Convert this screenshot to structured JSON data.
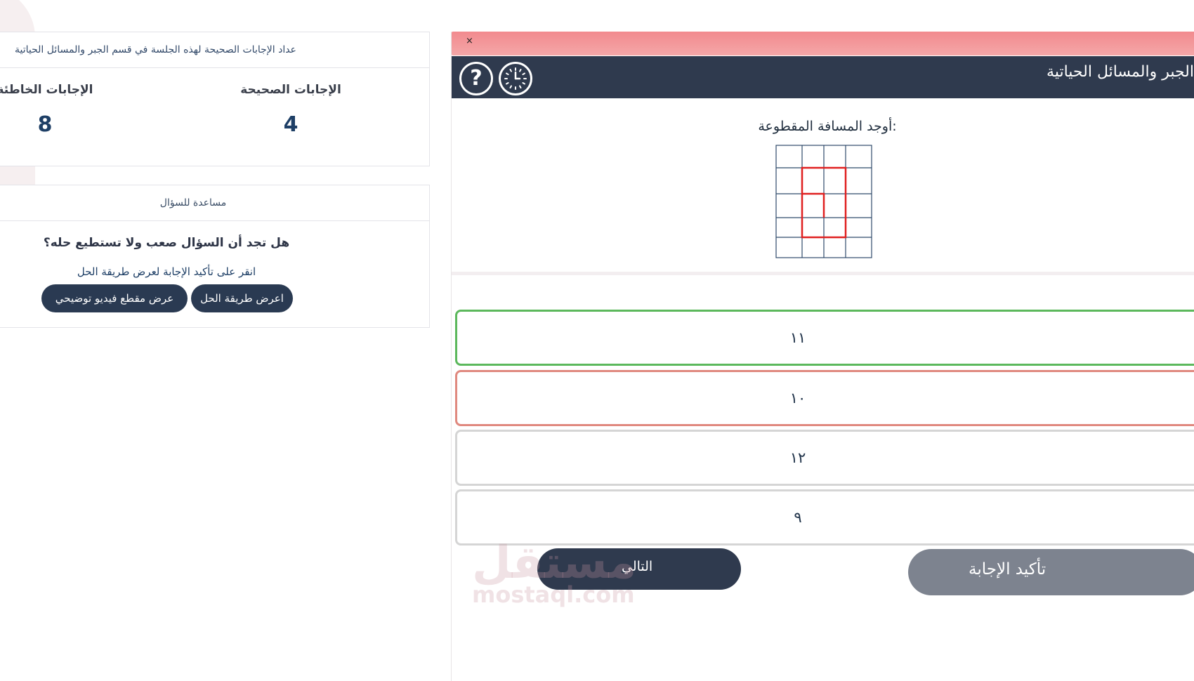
{
  "stats": {
    "header": "عداد الإجابات الصحيحة لهذه الجلسة في قسم الجبر والمسائل الحياتية",
    "correct_label": "الإجابات الصحيحة",
    "correct_value": "4",
    "wrong_label": "الإجابات الخاطئة",
    "wrong_value": "8"
  },
  "help": {
    "header": "مساعدة للسؤال",
    "question": "هل تجد أن السؤال صعب ولا تستطيع حله؟",
    "hint": "انقر على تأكيد الإجابة لعرض طريقة الحل",
    "solution_button": "اعرض طريقة الحل",
    "video_button": "عرض مقطع فيديو توضيحي"
  },
  "quiz": {
    "alert_close": "×",
    "title": "الجبر والمسائل الحياتية",
    "icons": [
      "question-mark-icon",
      "clock-icon"
    ],
    "prompt": "أوجد المسافة المقطوعة:",
    "options": [
      {
        "label": "١١",
        "state": "correct"
      },
      {
        "label": "١٠",
        "state": "wrong"
      },
      {
        "label": "١٢",
        "state": "none"
      },
      {
        "label": "٩",
        "state": "none"
      }
    ],
    "next_button": "التالي",
    "confirm_button": "تأكيد الإجابة"
  },
  "watermark": {
    "arabic": "مستقل",
    "latin": "mostaql.com"
  },
  "colors": {
    "header_bg": "#2f3a4e",
    "alert_bg": "#f28a8e",
    "correct_border": "#5cb85c",
    "wrong_border": "#e0897f",
    "confirm_bg": "#7d838f",
    "grid_line": "#2f4a6a",
    "path_red": "#e02020"
  }
}
